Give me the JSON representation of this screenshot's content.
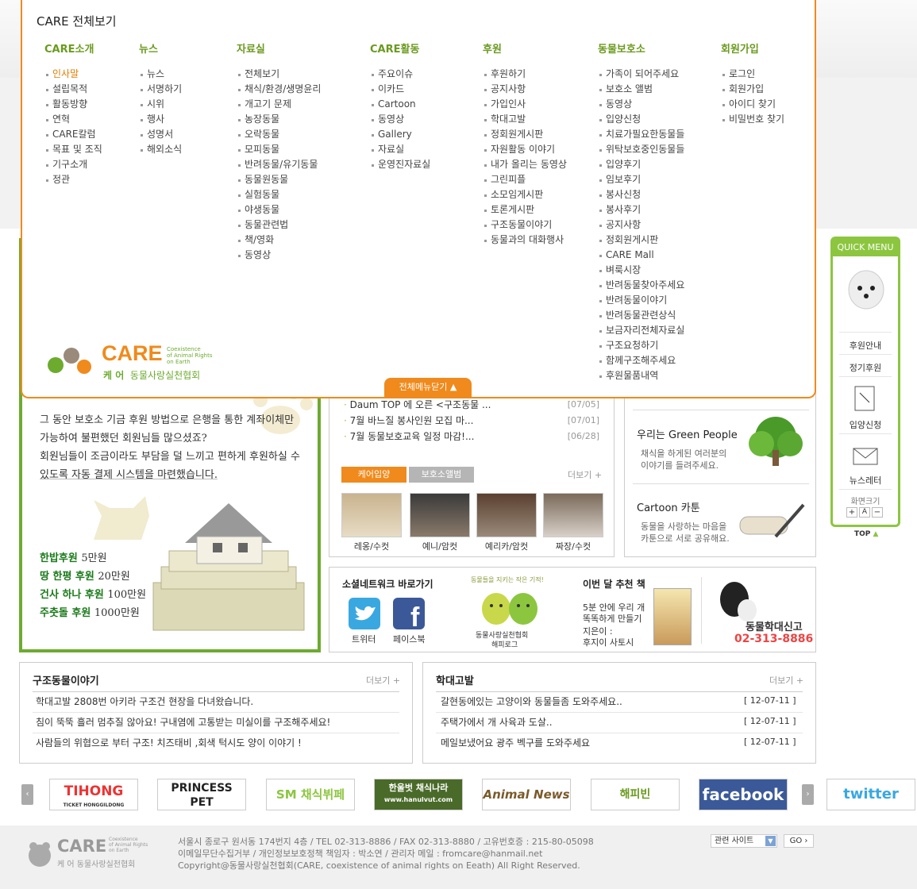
{
  "mega_menu": {
    "title": "CARE 전체보기",
    "close_label": "전체메뉴닫기",
    "columns": [
      {
        "heading": "CARE소개",
        "items": [
          "인사말",
          "설립목적",
          "활동방향",
          "연혁",
          "CARE칼럼",
          "목표 및 조직",
          "기구소개",
          "정관"
        ],
        "active": 0
      },
      {
        "heading": "뉴스",
        "items": [
          "뉴스",
          "서명하기",
          "시위",
          "행사",
          "성명서",
          "해외소식"
        ]
      },
      {
        "heading": "자료실",
        "items": [
          "전체보기",
          "채식/환경/생명윤리",
          "개고기 문제",
          "농장동물",
          "오락동물",
          "모피동물",
          "반려동물/유기동물",
          "동물원동물",
          "실험동물",
          "야생동물",
          "동물관련법",
          "책/영화",
          "동영상"
        ]
      },
      {
        "heading": "CARE활동",
        "items": [
          "주요이슈",
          "이카드",
          "Cartoon",
          "동영상",
          "Gallery",
          "자료실",
          "운영진자료실"
        ]
      },
      {
        "heading": "후원",
        "items": [
          "후원하기",
          "공지사항",
          "가입인사",
          "학대고발",
          "정회원게시판",
          "자원활동 이야기",
          "내가 올리는 동영상",
          "그린피플",
          "소모임게시판",
          "토론게시판",
          "구조동물이야기",
          "동물과의 대화행사"
        ]
      },
      {
        "heading": "동물보호소",
        "items": [
          "가족이 되어주세요",
          "보호소 앨범",
          "동영상",
          "입양신청",
          "치료가필요한동물들",
          "위탁보호중인동물들",
          "입양후기",
          "임보후기",
          "봉사신청",
          "봉사후기",
          "공지사항",
          "정회원게시판",
          "CARE Mall",
          "벼룩시장",
          "반려동물찾아주세요",
          "반려동물이야기",
          "반려동물관련상식",
          "보금자리전체자료실",
          "구조요청하기",
          "함께구조해주세요",
          "후원물품내역"
        ]
      },
      {
        "heading": "회원가입",
        "items": [
          "로그인",
          "회원가입",
          "아이디 찾기",
          "비밀번호 찾기"
        ]
      }
    ]
  },
  "logo": {
    "name": "CARE",
    "tag1": "Coexistence",
    "tag2": "of Animal Rights",
    "tag3": "on Earth",
    "korean1": "케 어",
    "korean2": "동물사랑실천협회"
  },
  "donate": {
    "lines": [
      "그 동안 보호소 기금 후원 방법으로 은행을 통한 계좌이체만",
      "가능하여 불편했던 회원님들 많으셨죠?",
      "회원님들이 조금이라도 부담을 덜 느끼고 편하게 후원하실 수",
      "있도록 자동 결제 시스템을 마련했습니다."
    ],
    "amounts": [
      {
        "label": "한밥후원",
        "value": "5만원"
      },
      {
        "label": "땅 한평 후원",
        "value": "20만원"
      },
      {
        "label": "건사 하나 후원",
        "value": "100만원"
      },
      {
        "label": "주춧돌 후원",
        "value": "1000만원"
      }
    ]
  },
  "notices": [
    {
      "title": "Daum TOP 에 오른 <구조동물 ...",
      "date": "[07/05]"
    },
    {
      "title": "7월 바느질 봉사인원 모집 마...",
      "date": "[07/01]"
    },
    {
      "title": "7월 동물보호교육 일정 마감!...",
      "date": "[06/28]"
    }
  ],
  "adoption": {
    "tab1": "케어입양",
    "tab2": "보호소앨범",
    "more": "더보기",
    "animals": [
      "레옹/수컷",
      "예니/암컷",
      "예리카/암컷",
      "짜장/수컷"
    ]
  },
  "promo": [
    {
      "title": "우리는 Green People",
      "desc1": "채식을 하게된 여러분의",
      "desc2": "이야기를 들려주세요."
    },
    {
      "title": "Cartoon 카툰",
      "desc1": "동물을 사랑하는 마음을",
      "desc2": "카툰으로 서로 공유해요."
    }
  ],
  "social": {
    "title": "소셜네트워크 바로가기",
    "twitter": "트위터",
    "facebook": "페이스북",
    "mascot_top": "동물들을 지키는 작은 기적!",
    "mascot1": "동물사랑실천협회",
    "mascot2": "해피로그"
  },
  "book": {
    "heading": "이번 달 추천 책",
    "line1": "5분 안에 우리 개",
    "line2": "똑똑하게 만들기",
    "author1": "지은이 :",
    "author2": "후지이 사토시"
  },
  "report": {
    "label": "동물학대신고",
    "phone": "02-313-8886"
  },
  "quick": {
    "title": "QUICK MENU",
    "items": [
      "후원안내",
      "정기후원",
      "입양신청",
      "뉴스레터"
    ],
    "font_label": "화면크기",
    "top": "TOP"
  },
  "rescue": {
    "title": "구조동물이야기",
    "more": "더보기",
    "items": [
      "학대고발 2808번 아키라 구조건 현장을 다녀왔습니다.",
      "침이 뚝뚝 흘러 멈추질 않아요! 구내염에 고통받는 미실이를 구조해주세요!",
      "사람들의 위협으로 부터 구조! 치즈태비 ,회색 턱시도 양이 이야기 !"
    ]
  },
  "abuse": {
    "title": "학대고발",
    "more": "더보기",
    "items": [
      {
        "title": "갈현동에있는 고양이와 동물들좀 도와주세요..",
        "date": "[ 12-07-11 ]"
      },
      {
        "title": "주택가에서 개 사육과 도살..",
        "date": "[ 12-07-11 ]"
      },
      {
        "title": "메일보냈어요 광주 벡구를 도와주세요",
        "date": "[ 12-07-11 ]"
      }
    ]
  },
  "banners": [
    "TIHONG",
    "PRINCESS PET",
    "SM 채식뷔페",
    "한울벗 채식나라",
    "Animal News",
    "해피빈",
    "facebook",
    "twitter"
  ],
  "banner_sub": {
    "tihong": "TICKET HONGGILDONG",
    "hanul": "www.hanulvut.com"
  },
  "footer": {
    "line1": "서울시 종로구 원서동 174번지 4층 / TEL 02-313-8886 / FAX 02-313-8880 / 고유번호증 : 215-80-05098",
    "line2": "이메일무단수집거부 / 개인정보보호정책 책임자 : 박소연 / 관리자 메일 : fromcare@hanmail.net",
    "line3": "Copyright@동물사랑실천협회(CARE, coexistence of animal rights on Eeath) All Right Reserved.",
    "related": "관련 사이트",
    "go": "GO"
  },
  "colors": {
    "orange": "#f08a1c",
    "green": "#6dab2f",
    "quick_green": "#8cc63f"
  }
}
